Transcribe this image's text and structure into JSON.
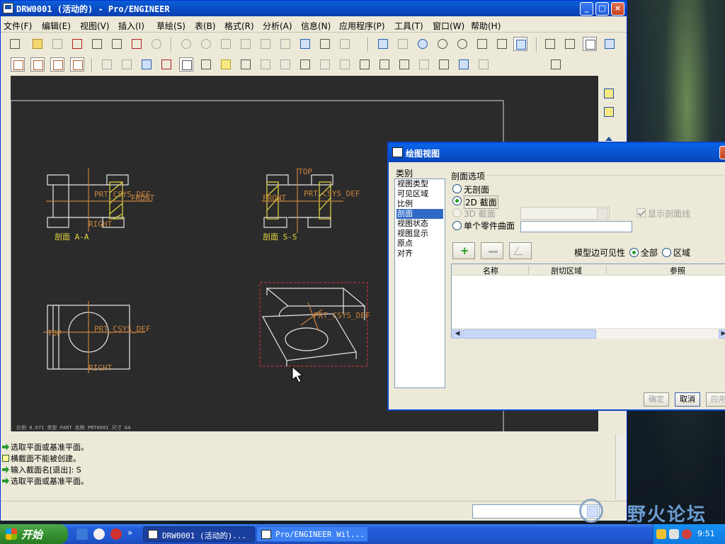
{
  "window": {
    "title": "DRW0001 (活动的) - Pro/ENGINEER",
    "controls": {
      "minimize": "_",
      "maximize": "□",
      "close": "×"
    }
  },
  "menu": [
    {
      "label": "文件(F)"
    },
    {
      "label": "编辑(E)"
    },
    {
      "label": "视图(V)"
    },
    {
      "label": "插入(I)"
    },
    {
      "label": "草绘(S)"
    },
    {
      "label": "表(B)"
    },
    {
      "label": "格式(R)"
    },
    {
      "label": "分析(A)"
    },
    {
      "label": "信息(N)"
    },
    {
      "label": "应用程序(P)"
    },
    {
      "label": "工具(T)"
    },
    {
      "label": "窗口(W)"
    },
    {
      "label": "帮助(H)"
    }
  ],
  "toolbar": {
    "spin_value": "0"
  },
  "drawing": {
    "views": {
      "section_aa": {
        "caption": "剖面 A-A",
        "csys": "PRT_CSYS_DEF",
        "labels": [
          "FRONT",
          "RIGHT"
        ]
      },
      "section_ss": {
        "caption": "剖面 S-S",
        "csys": "PRT_CSYS_DEF",
        "labels": [
          "TOP",
          "FRONT"
        ]
      },
      "top_view": {
        "csys": "PRT_CSYS_DEF",
        "labels": [
          "TOP",
          "RIGHT"
        ]
      },
      "iso_view": {
        "csys": "PRT_CSYS_DEF"
      }
    },
    "status_text": "比例 0.071   类型 PART   名称 PRT0001   尺寸 A4",
    "colors": {
      "geometry": "#e8e8e8",
      "datum": "#c8823c",
      "section_hatch": "#e6d840",
      "highlight": "#d03040",
      "background": "#2b2b2b"
    }
  },
  "messages": [
    {
      "icon": "arrow",
      "text": "选取平面或基准平面。"
    },
    {
      "icon": "warn",
      "text": "横截面不能被创建。"
    },
    {
      "icon": "arrow",
      "text": "输入截面名[退出]:   S"
    },
    {
      "icon": "arrow",
      "text": "选取平面或基准平面。"
    }
  ],
  "dialog": {
    "title": "绘图视图",
    "category_label": "类别",
    "categories": [
      {
        "label": "视图类型"
      },
      {
        "label": "可见区域"
      },
      {
        "label": "比例"
      },
      {
        "label": "剖面"
      },
      {
        "label": "视图状态"
      },
      {
        "label": "视图显示"
      },
      {
        "label": "原点"
      },
      {
        "label": "对齐"
      }
    ],
    "selected_category": "剖面",
    "section_options_label": "剖面选项",
    "options": {
      "none": "无剖面",
      "section_2d": "2D 截面",
      "section_3d": "3D 截面",
      "single_part": "单个零件曲面",
      "show_hatch": "显示剖面线"
    },
    "selected_option": "2D 截面",
    "edge_visibility_label": "模型边可见性",
    "edge_options": {
      "all": "全部",
      "area": "区域"
    },
    "edge_selected": "全部",
    "table_columns": [
      "名称",
      "剖切区域",
      "参照"
    ],
    "buttons": {
      "ok": "确定",
      "cancel": "取消",
      "apply": "应用"
    }
  },
  "taskbar": {
    "start": "开始",
    "tasks": [
      {
        "label": "DRW0001 (活动的)..."
      },
      {
        "label": "Pro/ENGINEER Wil..."
      }
    ],
    "clock": "9:51",
    "more": "»"
  },
  "watermark": {
    "text": "野火论坛"
  }
}
